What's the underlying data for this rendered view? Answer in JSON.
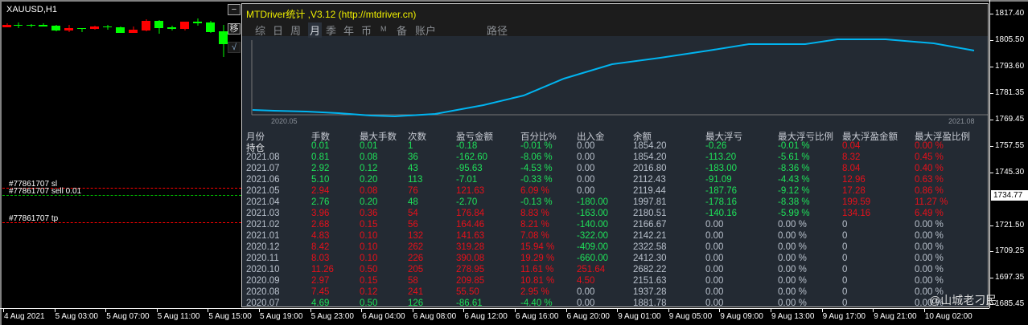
{
  "chart": {
    "symbol_title": "XAUUSD,H1",
    "side_buttons": [
      "−",
      "移",
      "√"
    ],
    "order_lines": {
      "sl": "#77861707 sl",
      "sell": "#77861707 sell 0.01",
      "tp": "#77861707 tp"
    },
    "colors": {
      "bull": "#00ff00",
      "bear": "#ff0000",
      "sl_tp": "#ff0000",
      "entry": "#00c000"
    }
  },
  "panel": {
    "title": "MTDriver统计 ,V3.12 (http://mtdriver.cn)",
    "tabs": [
      "综",
      "日",
      "周",
      "月",
      "季",
      "年",
      "币",
      "M",
      "备",
      "账户",
      "路径"
    ],
    "active_tab": "月",
    "curve": {
      "start_label": "2020.05",
      "end_label": "2021.08",
      "color": "#00b4f0"
    },
    "columns": [
      "月份",
      "手数",
      "最大手数",
      "次数",
      "盈亏金额",
      "百分比%",
      "出入金",
      "余额",
      "最大浮亏",
      "最大浮亏比例",
      "最大浮盈金额",
      "最大浮盈比例"
    ],
    "rows": [
      {
        "cells": [
          "持仓",
          "0.01",
          "0.01",
          "1",
          "-0.18",
          "-0.01 %",
          "0.00",
          "1854.20",
          "-0.26",
          "-0.01 %",
          "0.04",
          "0.00 %"
        ],
        "colors": "bgggggwwggrr"
      },
      {
        "cells": [
          "2021.08",
          "0.81",
          "0.08",
          "36",
          "-162.60",
          "-8.06 %",
          "0.00",
          "1854.20",
          "-113.20",
          "-5.61 %",
          "8.32",
          "0.45 %"
        ],
        "colors": "wgggggwwggrr"
      },
      {
        "cells": [
          "2021.07",
          "2.92",
          "0.12",
          "43",
          "-95.63",
          "-4.53 %",
          "0.00",
          "2016.80",
          "-183.00",
          "-8.36 %",
          "8.04",
          "0.40 %"
        ],
        "colors": "wgggggwwggrr"
      },
      {
        "cells": [
          "2021.06",
          "5.10",
          "0.20",
          "113",
          "-7.01",
          "-0.33 %",
          "0.00",
          "2112.43",
          "-91.09",
          "-4.43 %",
          "12.96",
          "0.63 %"
        ],
        "colors": "wgggggwwggrr"
      },
      {
        "cells": [
          "2021.05",
          "2.94",
          "0.08",
          "76",
          "121.63",
          "6.09 %",
          "0.00",
          "2119.44",
          "-187.76",
          "-9.12 %",
          "17.28",
          "0.86 %"
        ],
        "colors": "wrrrrrwwggrr"
      },
      {
        "cells": [
          "2021.04",
          "2.76",
          "0.20",
          "48",
          "-2.70",
          "-0.13 %",
          "-180.00",
          "1997.81",
          "-178.16",
          "-8.38 %",
          "199.59",
          "11.27 %"
        ],
        "colors": "wggggggwggrr"
      },
      {
        "cells": [
          "2021.03",
          "3.96",
          "0.36",
          "54",
          "176.84",
          "8.83 %",
          "-163.00",
          "2180.51",
          "-140.16",
          "-5.99 %",
          "134.16",
          "6.49 %"
        ],
        "colors": "wrrrrrgwggrr"
      },
      {
        "cells": [
          "2021.02",
          "2.68",
          "0.15",
          "56",
          "164.46",
          "8.21 %",
          "-140.00",
          "2166.67",
          "0.00",
          "0.00 %",
          "0",
          "0.00 %"
        ],
        "colors": "wrrrrrgwwwww"
      },
      {
        "cells": [
          "2021.01",
          "4.83",
          "0.10",
          "132",
          "141.63",
          "7.08 %",
          "-322.00",
          "2142.21",
          "0.00",
          "0.00 %",
          "0",
          "0.00 %"
        ],
        "colors": "wrrrrrgwwwww"
      },
      {
        "cells": [
          "2020.12",
          "8.42",
          "0.10",
          "262",
          "319.28",
          "15.94 %",
          "-409.00",
          "2322.58",
          "0.00",
          "0.00 %",
          "0",
          "0.00 %"
        ],
        "colors": "wrrrrrgwwwww"
      },
      {
        "cells": [
          "2020.11",
          "8.03",
          "0.10",
          "226",
          "390.08",
          "19.29 %",
          "-660.00",
          "2412.30",
          "0.00",
          "0.00 %",
          "0",
          "0.00 %"
        ],
        "colors": "wrrrrrgwwwww"
      },
      {
        "cells": [
          "2020.10",
          "11.26",
          "0.50",
          "205",
          "278.95",
          "11.61 %",
          "251.64",
          "2682.22",
          "0.00",
          "0.00 %",
          "0",
          "0.00 %"
        ],
        "colors": "wrrrrrrwwwww"
      },
      {
        "cells": [
          "2020.09",
          "2.97",
          "0.15",
          "58",
          "209.85",
          "10.81 %",
          "4.50",
          "2151.63",
          "0.00",
          "0.00 %",
          "0",
          "0.00 %"
        ],
        "colors": "wrrrrrrwwwww"
      },
      {
        "cells": [
          "2020.08",
          "7.45",
          "0.12",
          "241",
          "55.50",
          "2.95 %",
          "0.00",
          "1937.28",
          "0.00",
          "0.00 %",
          "0",
          "0.00 %"
        ],
        "colors": "wrrrrrwwwwww"
      },
      {
        "cells": [
          "2020.07",
          "4.69",
          "0.50",
          "126",
          "-86.61",
          "-4.40 %",
          "0.00",
          "1881.78",
          "0.00",
          "0.00 %",
          "0",
          "0.00 %"
        ],
        "colors": "wgggggwwwwww"
      }
    ]
  },
  "price_axis": {
    "labels": [
      "1817.40",
      "1805.50",
      "1793.60",
      "1781.35",
      "1769.45",
      "1757.55",
      "1745.30",
      "1721.50",
      "1709.25",
      "1697.35",
      "1685.45"
    ],
    "current_price": "1734.77"
  },
  "time_axis": {
    "labels": [
      "4 Aug 2021",
      "5 Aug 03:00",
      "5 Aug 07:00",
      "5 Aug 11:00",
      "5 Aug 15:00",
      "5 Aug 19:00",
      "5 Aug 23:00",
      "6 Aug 04:00",
      "6 Aug 08:00",
      "6 Aug 12:00",
      "6 Aug 16:00",
      "6 Aug 20:00",
      "9 Aug 01:00",
      "9 Aug 05:00",
      "9 Aug 09:00",
      "9 Aug 13:00",
      "9 Aug 17:00",
      "9 Aug 21:00",
      "10 Aug 02:00"
    ]
  },
  "watermark": "@山城老刁民"
}
